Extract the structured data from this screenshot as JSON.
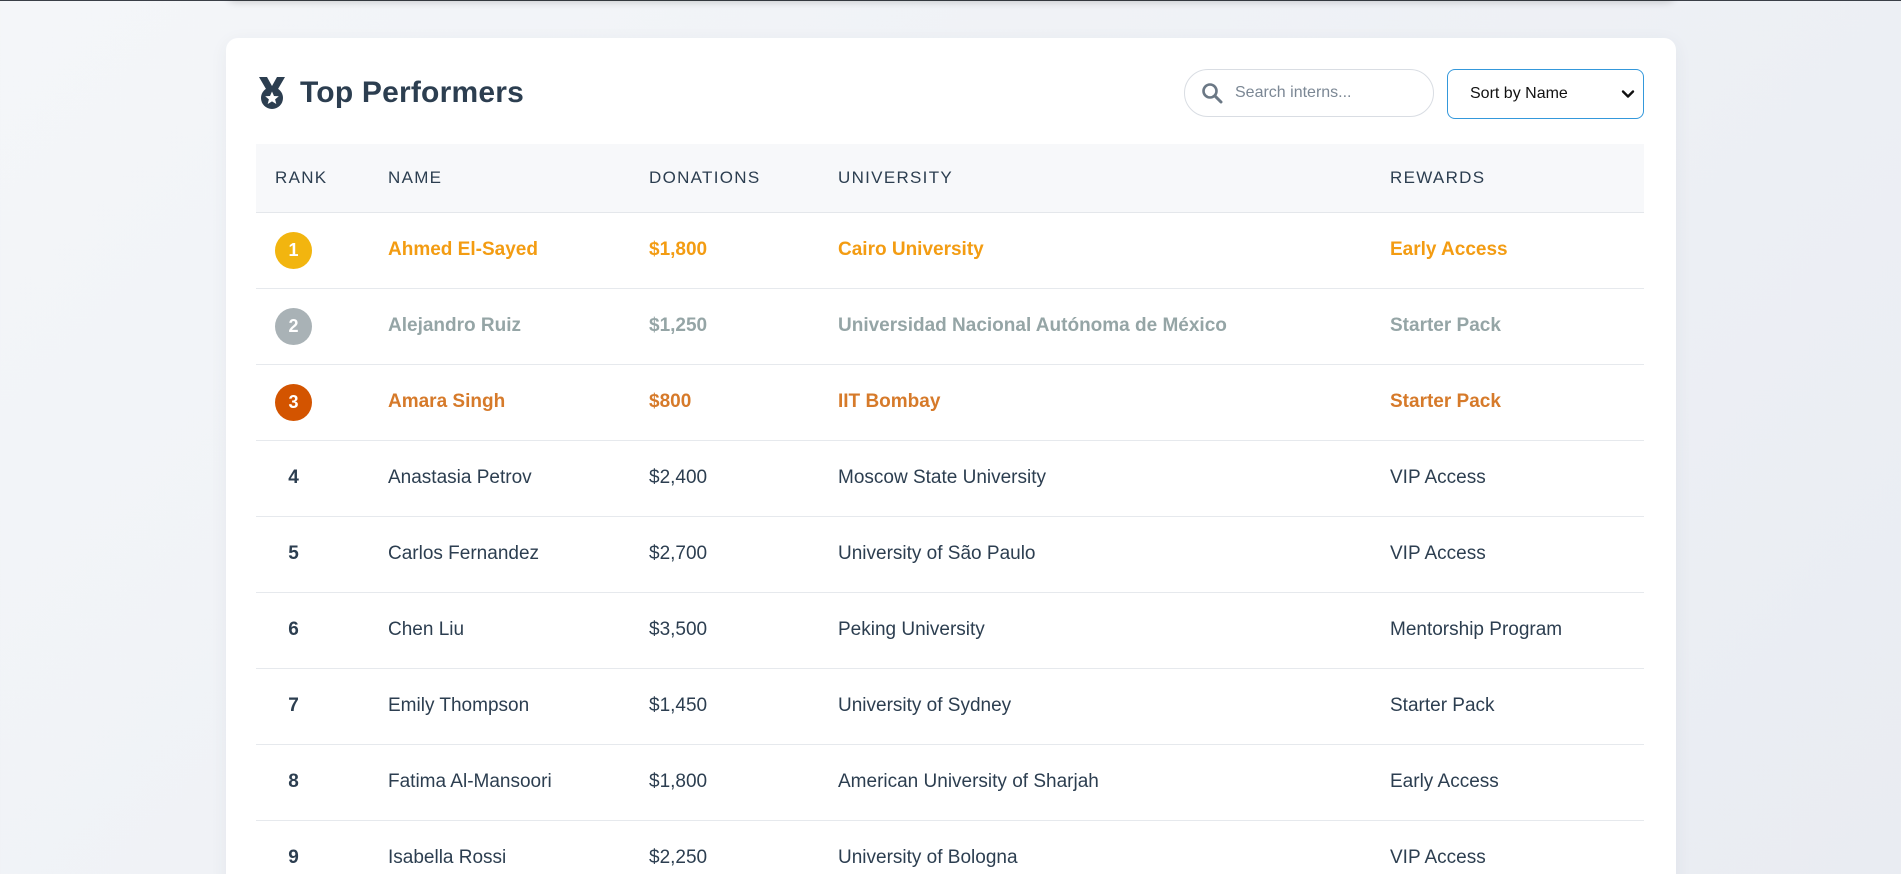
{
  "header": {
    "title": "Top Performers",
    "icon": "medal-icon"
  },
  "search": {
    "placeholder": "Search interns...",
    "value": "",
    "icon": "search-icon"
  },
  "sort": {
    "selected": "Sort by Name",
    "icon": "chevron-down-icon"
  },
  "table": {
    "columns": [
      "RANK",
      "NAME",
      "DONATIONS",
      "UNIVERSITY",
      "REWARDS"
    ],
    "rows": [
      {
        "rank": "1",
        "name": "Ahmed El-Sayed",
        "donations": "$1,800",
        "university": "Cairo University",
        "reward": "Early Access",
        "tier": "gold"
      },
      {
        "rank": "2",
        "name": "Alejandro Ruiz",
        "donations": "$1,250",
        "university": "Universidad Nacional Autónoma de México",
        "reward": "Starter Pack",
        "tier": "silver"
      },
      {
        "rank": "3",
        "name": "Amara Singh",
        "donations": "$800",
        "university": "IIT Bombay",
        "reward": "Starter Pack",
        "tier": "bronze"
      },
      {
        "rank": "4",
        "name": "Anastasia Petrov",
        "donations": "$2,400",
        "university": "Moscow State University",
        "reward": "VIP Access",
        "tier": ""
      },
      {
        "rank": "5",
        "name": "Carlos Fernandez",
        "donations": "$2,700",
        "university": "University of São Paulo",
        "reward": "VIP Access",
        "tier": ""
      },
      {
        "rank": "6",
        "name": "Chen Liu",
        "donations": "$3,500",
        "university": "Peking University",
        "reward": "Mentorship Program",
        "tier": ""
      },
      {
        "rank": "7",
        "name": "Emily Thompson",
        "donations": "$1,450",
        "university": "University of Sydney",
        "reward": "Starter Pack",
        "tier": ""
      },
      {
        "rank": "8",
        "name": "Fatima Al-Mansoori",
        "donations": "$1,800",
        "university": "American University of Sharjah",
        "reward": "Early Access",
        "tier": ""
      },
      {
        "rank": "9",
        "name": "Isabella Rossi",
        "donations": "$2,250",
        "university": "University of Bologna",
        "reward": "VIP Access",
        "tier": ""
      }
    ]
  },
  "colors": {
    "gold": "#f39c12",
    "silver": "#95a5a6",
    "bronze": "#d67a2a",
    "accent": "#3498db",
    "text": "#2c3e50"
  }
}
